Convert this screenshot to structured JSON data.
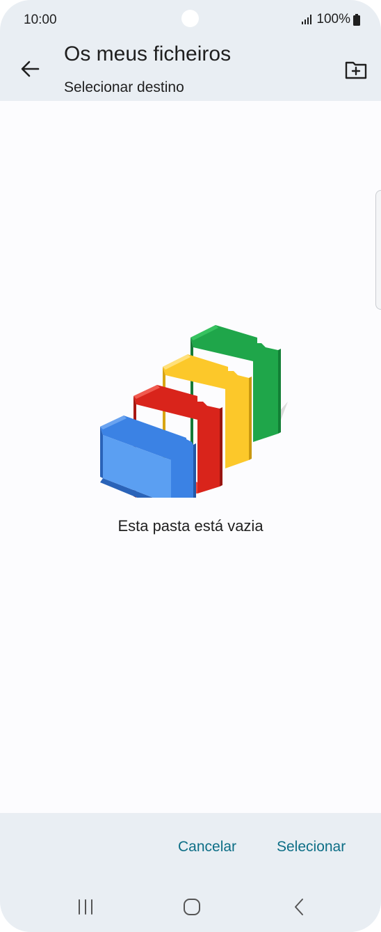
{
  "status_bar": {
    "time": "10:00",
    "battery": "100%"
  },
  "app_bar": {
    "title": "Os meus ficheiros",
    "subtitle": "Selecionar destino",
    "icons": {
      "back": "arrow-left-icon",
      "new_folder": "folder-plus-icon"
    }
  },
  "content": {
    "empty_message": "Esta pasta está vazia"
  },
  "actions": {
    "cancel_label": "Cancelar",
    "select_label": "Selecionar"
  },
  "colors": {
    "accent": "#0d6e86",
    "bar_background": "#e9eef3",
    "folder_blue": "#3b82e4",
    "folder_red": "#d9241b",
    "folder_yellow": "#fcc82a",
    "folder_green": "#1fa64a"
  }
}
